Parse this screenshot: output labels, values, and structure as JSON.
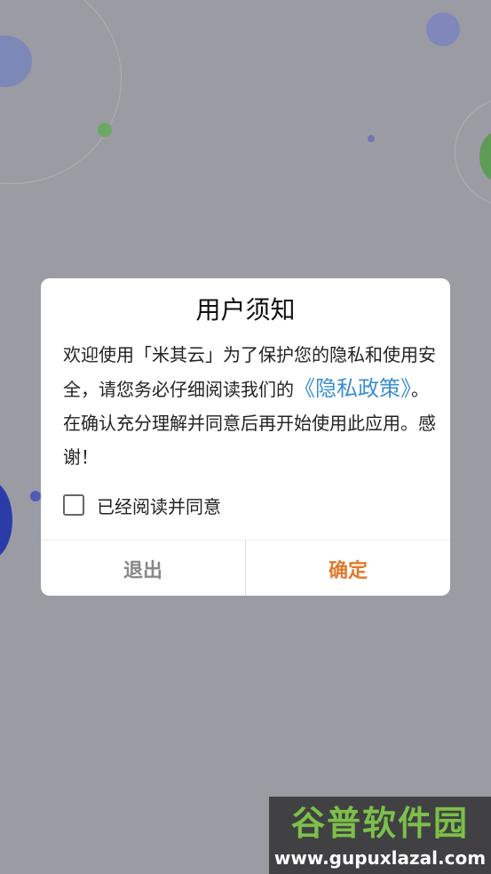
{
  "dialog": {
    "title": "用户须知",
    "body_before_link": "欢迎使用「米其云」为了保护您的隐私和使用安全，请您务必仔细阅读我们的",
    "policy_link": "《隐私政策》",
    "body_after_link": "。在确认充分理解并同意后再开始使用此应用。感谢！",
    "agree_label": "已经阅读并同意",
    "agree_checked": false,
    "exit_label": "退出",
    "confirm_label": "确定"
  },
  "colors": {
    "confirm": "#e07a2e",
    "link": "#3a8fd0",
    "exit": "#888888"
  },
  "watermark": {
    "brand": "谷普软件园",
    "url": "www.gupuxlazal.com"
  }
}
